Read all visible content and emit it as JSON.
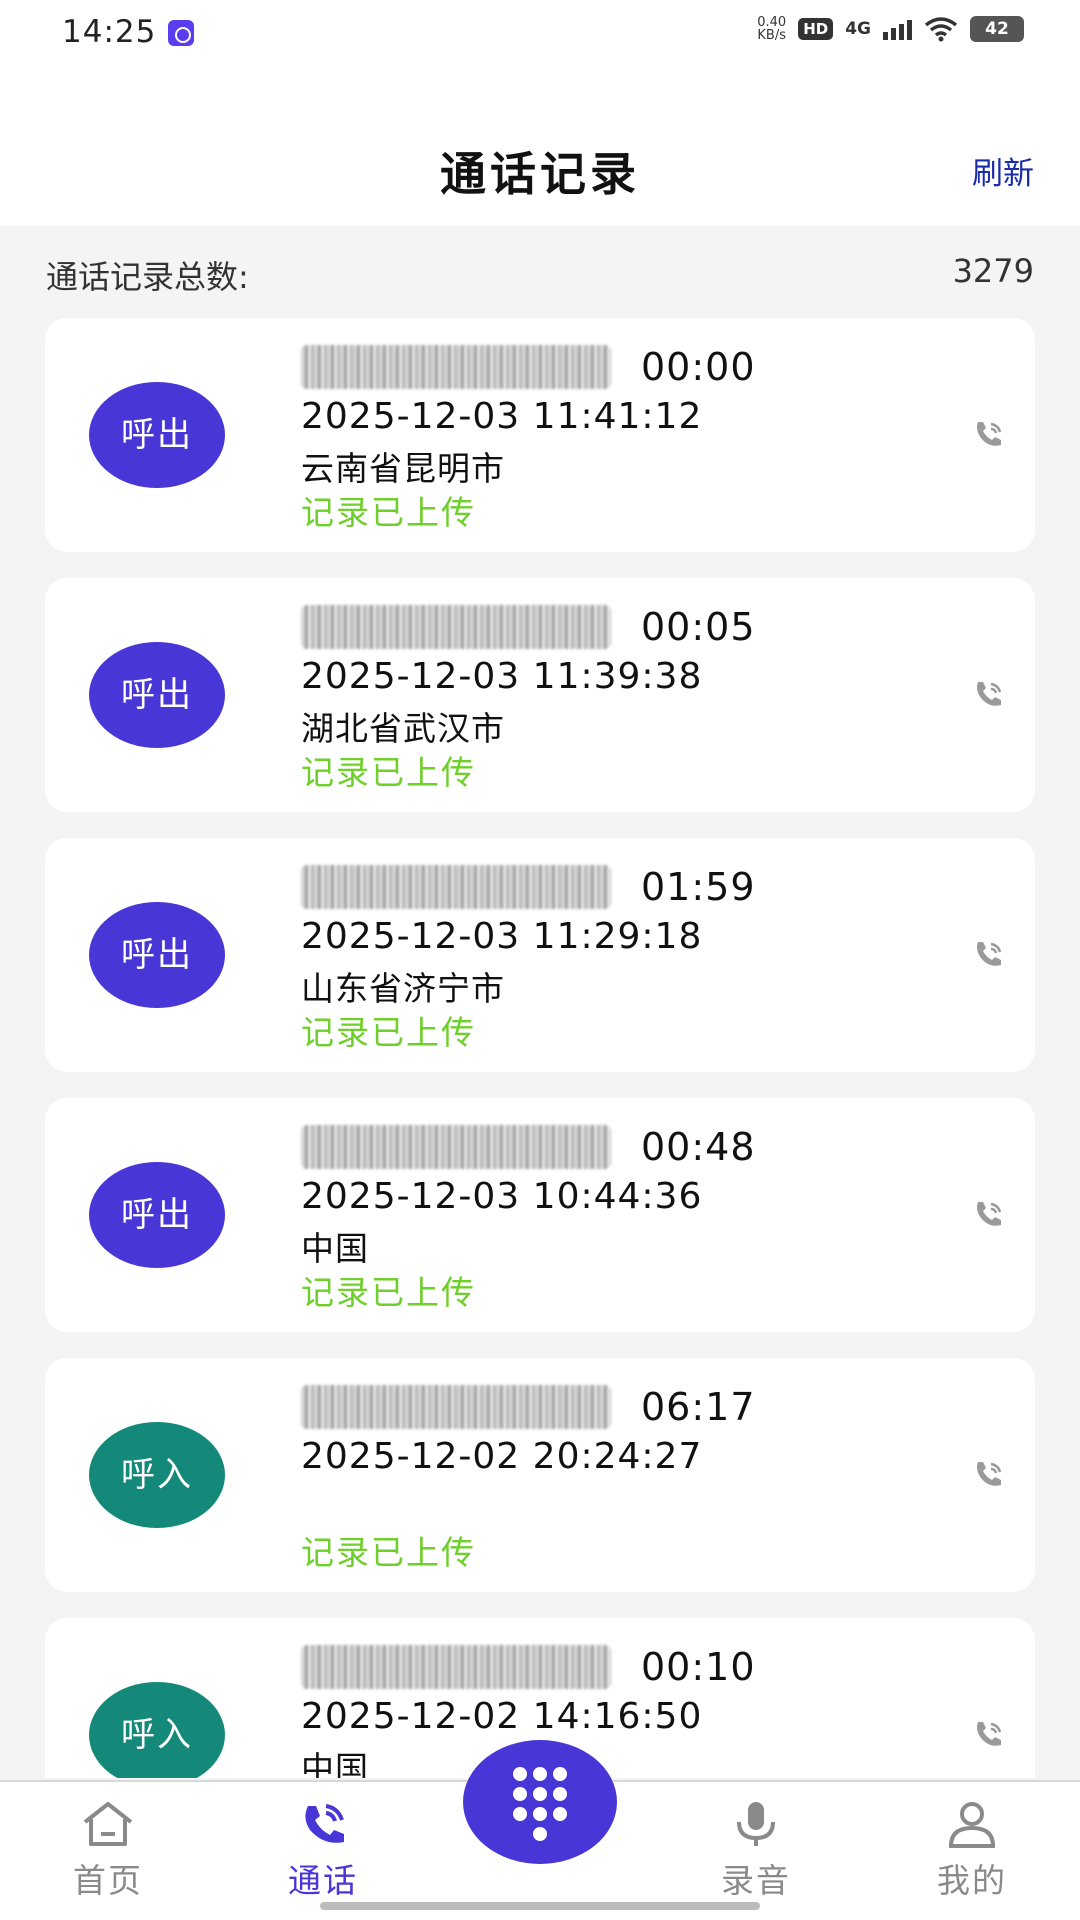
{
  "status_bar": {
    "time": "14:25",
    "net_speed_value": "0.40",
    "net_speed_unit": "KB/s",
    "hd": "HD",
    "network": "4G",
    "battery": "42"
  },
  "header": {
    "title": "通话记录",
    "refresh_label": "刷新"
  },
  "summary": {
    "label": "通话记录总数:",
    "count": "3279"
  },
  "records": [
    {
      "direction": "呼出",
      "duration": "00:00",
      "datetime": "2025-12-03 11:41:12",
      "location": "云南省昆明市",
      "status": "记录已上传"
    },
    {
      "direction": "呼出",
      "duration": "00:05",
      "datetime": "2025-12-03 11:39:38",
      "location": "湖北省武汉市",
      "status": "记录已上传"
    },
    {
      "direction": "呼出",
      "duration": "01:59",
      "datetime": "2025-12-03 11:29:18",
      "location": "山东省济宁市",
      "status": "记录已上传"
    },
    {
      "direction": "呼出",
      "duration": "00:48",
      "datetime": "2025-12-03 10:44:36",
      "location": "中国",
      "status": "记录已上传"
    },
    {
      "direction": "呼入",
      "duration": "06:17",
      "datetime": "2025-12-02 20:24:27",
      "location": "",
      "status": "记录已上传"
    },
    {
      "direction": "呼入",
      "duration": "00:10",
      "datetime": "2025-12-02 14:16:50",
      "location": "中国",
      "status": ""
    }
  ],
  "colors": {
    "accent": "#4836d6",
    "incoming": "#14897a",
    "uploaded": "#6fcf2b",
    "refresh": "#1a2ca8"
  },
  "nav": {
    "home": "首页",
    "calls": "通话",
    "recordings": "录音",
    "mine": "我的"
  },
  "icons": {
    "dialpad_fab": "dialpad-icon",
    "call_row": "phone-ringing-icon"
  }
}
